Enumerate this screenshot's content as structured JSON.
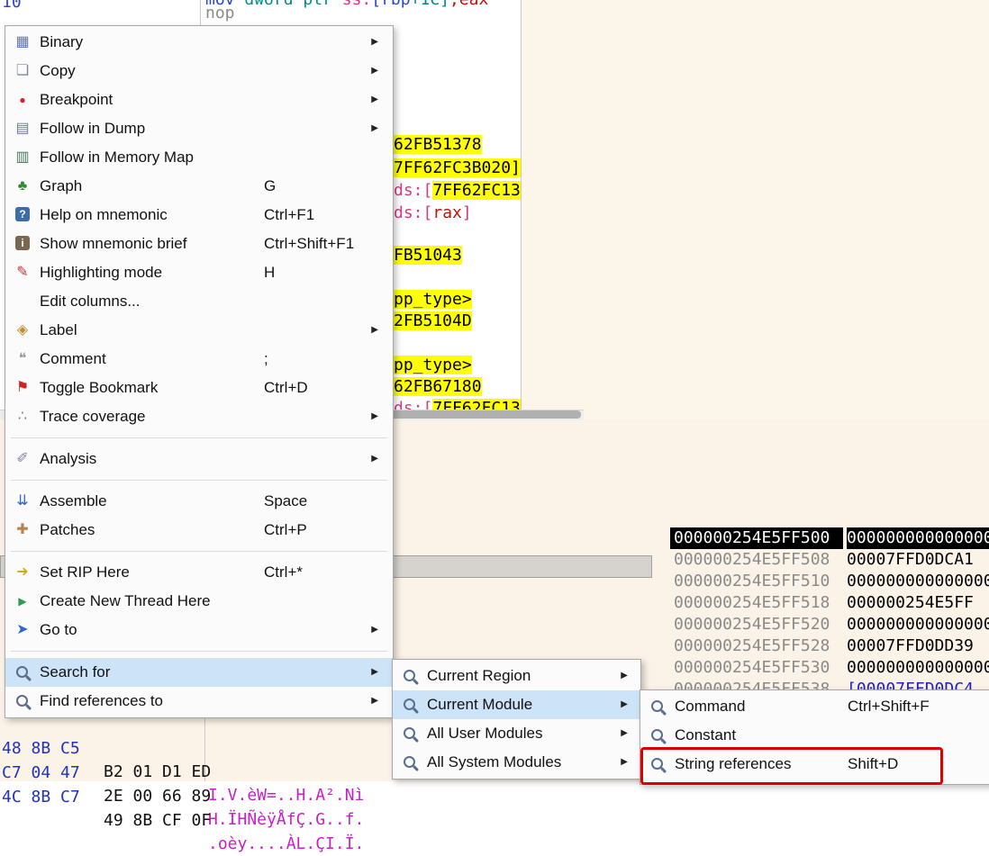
{
  "colors": {
    "hover_blue": "#cde4f8",
    "highlight_yellow": "#ffff00",
    "annotation_red": "#dd0000",
    "panel_cream": "#fbf3e7",
    "selection_black": "#000000",
    "address_gray": "#8a8a8a",
    "ascii_magenta": "#c820c8",
    "hex_blue": "#2233bb"
  },
  "disasm": {
    "corner": "10",
    "nop": "nop",
    "top_tokens": [
      {
        "t": "mov "
      },
      {
        "t": "dword ptr "
      },
      {
        "t": "ss:"
      },
      {
        "t": "[rbp"
      },
      {
        "t": "+1C]"
      },
      {
        "t": ",eax"
      }
    ],
    "fragments": [
      {
        "text": "62FB51378"
      },
      {
        "text": "7FF62FC3B020]"
      },
      {
        "prefix": "ds:[",
        "text": "7FF62FC13"
      },
      {
        "prefix": "ds:[",
        "reg": "rax",
        "suffix": "]"
      },
      {
        "text": "FB51043"
      },
      {
        "text": "pp_type>"
      },
      {
        "text": "2FB5104D"
      },
      {
        "text": "pp_type>"
      },
      {
        "text": "62FB67180"
      },
      {
        "prefix": "ds:[",
        "text": "7FF62FC13"
      }
    ]
  },
  "context_menu": {
    "items": [
      {
        "label": "Binary",
        "shortcut": "",
        "arrow": "▶",
        "icon": "▦"
      },
      {
        "label": "Copy",
        "shortcut": "",
        "arrow": "▶",
        "icon": "❏"
      },
      {
        "label": "Breakpoint",
        "shortcut": "",
        "arrow": "▶",
        "icon": "●"
      },
      {
        "label": "Follow in Dump",
        "shortcut": "",
        "arrow": "▶",
        "icon": "▤"
      },
      {
        "label": "Follow in Memory Map",
        "shortcut": "",
        "arrow": "",
        "icon": "▥"
      },
      {
        "label": "Graph",
        "shortcut": "G",
        "arrow": "",
        "icon": "♣"
      },
      {
        "label": "Help on mnemonic",
        "shortcut": "Ctrl+F1",
        "arrow": "",
        "icon": "?"
      },
      {
        "label": "Show mnemonic brief",
        "shortcut": "Ctrl+Shift+F1",
        "arrow": "",
        "icon": "i"
      },
      {
        "label": "Highlighting mode",
        "shortcut": "H",
        "arrow": "",
        "icon": "✎"
      },
      {
        "label": "Edit columns...",
        "shortcut": "",
        "arrow": "",
        "icon": ""
      },
      {
        "label": "Label",
        "shortcut": "",
        "arrow": "▶",
        "icon": "◈"
      },
      {
        "label": "Comment",
        "shortcut": ";",
        "arrow": "",
        "icon": "❝"
      },
      {
        "label": "Toggle Bookmark",
        "shortcut": "Ctrl+D",
        "arrow": "",
        "icon": "⚑"
      },
      {
        "label": "Trace coverage",
        "shortcut": "",
        "arrow": "▶",
        "icon": "∴"
      },
      {
        "label": "Analysis",
        "shortcut": "",
        "arrow": "▶",
        "icon": "✐"
      },
      {
        "label": "Assemble",
        "shortcut": "Space",
        "arrow": "",
        "icon": "⇊"
      },
      {
        "label": "Patches",
        "shortcut": "Ctrl+P",
        "arrow": "",
        "icon": "✚"
      },
      {
        "label": "Set RIP Here",
        "shortcut": "Ctrl+*",
        "arrow": "",
        "icon": "➜"
      },
      {
        "label": "Create New Thread Here",
        "shortcut": "",
        "arrow": "",
        "icon": "▶"
      },
      {
        "label": "Go to",
        "shortcut": "",
        "arrow": "▶",
        "icon": "➤"
      },
      {
        "label": "Search for",
        "shortcut": "",
        "arrow": "▶",
        "icon": ""
      },
      {
        "label": "Find references to",
        "shortcut": "",
        "arrow": "▶",
        "icon": ""
      }
    ]
  },
  "search_submenu": {
    "items": [
      {
        "label": "Current Region",
        "arrow": "▶"
      },
      {
        "label": "Current Module",
        "arrow": "▶"
      },
      {
        "label": "All User Modules",
        "arrow": "▶"
      },
      {
        "label": "All System Modules",
        "arrow": "▶"
      }
    ]
  },
  "module_submenu": {
    "items": [
      {
        "label": "Command",
        "shortcut": "Ctrl+Shift+F"
      },
      {
        "label": "Constant",
        "shortcut": ""
      },
      {
        "label": "String references",
        "shortcut": "Shift+D"
      }
    ]
  },
  "stack_panel": {
    "rows": [
      {
        "address": "000000254E5FF500",
        "value": "000000000000000"
      },
      {
        "address": "000000254E5FF508",
        "value": "00007FFD0DCA1"
      },
      {
        "address": "000000254E5FF510",
        "value": "000000000000000"
      },
      {
        "address": "000000254E5FF518",
        "value": "000000254E5FF"
      },
      {
        "address": "000000254E5FF520",
        "value": "000000000000000"
      },
      {
        "address": "000000254E5FF528",
        "value": "00007FFD0DD39"
      },
      {
        "address": "000000254E5FF530",
        "value": "000000000000000"
      },
      {
        "address": "000000254E5FF538",
        "value": "[00007FFD0DC4"
      }
    ]
  },
  "hex_dump": {
    "rows": [
      {
        "bytes_a": "48 8B C5",
        "bytes_b": "B2 01 D1 ED",
        "ascii": "I.V.èW=..H.A².Nì"
      },
      {
        "bytes_a": "C7 04 47",
        "bytes_b": "2E 00 66 89",
        "ascii": "H.ÏHÑèÿÅfÇ.G..f."
      },
      {
        "bytes_a": "4C 8B C7",
        "bytes_b": "49 8B CF 0F",
        "ascii": ".oèy....ÀL.ÇI.Ï."
      }
    ]
  }
}
